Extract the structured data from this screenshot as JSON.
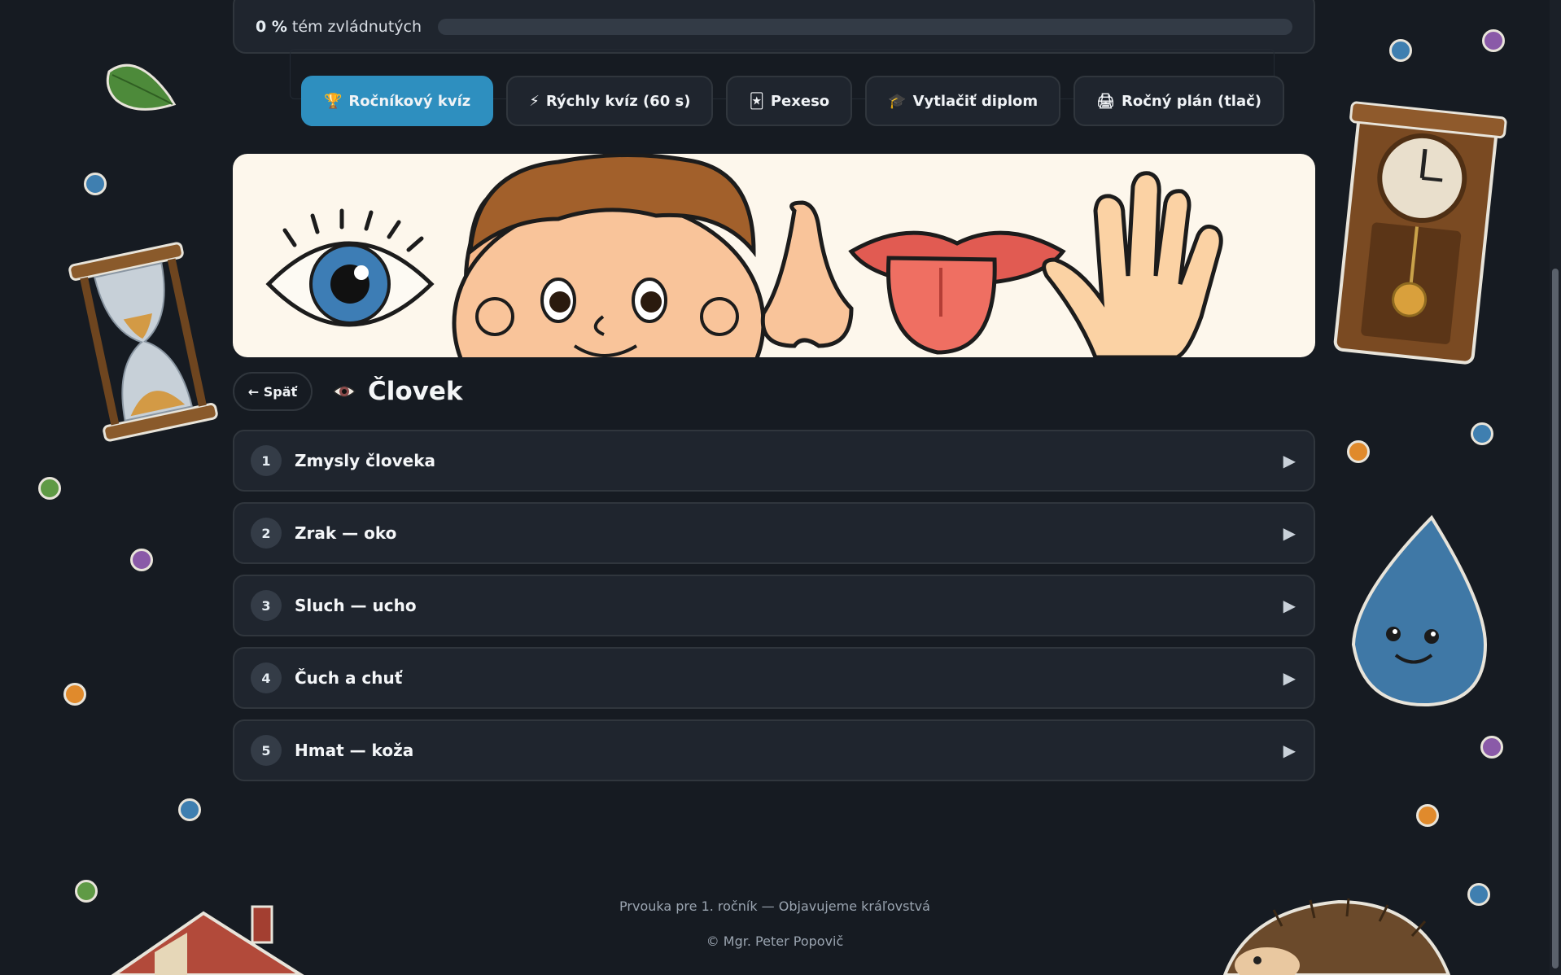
{
  "progress": {
    "percent_label": "0 %",
    "label": "tém zvládnutých",
    "value": 0
  },
  "toolbar": [
    {
      "id": "grade-quiz",
      "icon": "trophy-icon",
      "glyph": "🏆",
      "label": "Ročníkový kvíz",
      "active": true
    },
    {
      "id": "quick-quiz",
      "icon": "lightning-icon",
      "glyph": "⚡",
      "label": "Rýchly kvíz (60 s)",
      "active": false
    },
    {
      "id": "pexeso",
      "icon": "cards-icon",
      "glyph": "🃏",
      "label": "Pexeso",
      "active": false
    },
    {
      "id": "diploma",
      "icon": "graduation-cap-icon",
      "glyph": "🎓",
      "label": "Vytlačiť diplom",
      "active": false
    },
    {
      "id": "annual-plan",
      "icon": "printer-icon",
      "glyph": "🖨",
      "label": "Ročný plán (tlač)",
      "active": false
    }
  ],
  "header": {
    "back_label": "← Späť",
    "title_icon": "eye-icon",
    "title": "Človek"
  },
  "topics": [
    {
      "num": "1",
      "label": "Zmysly človeka"
    },
    {
      "num": "2",
      "label": "Zrak — oko"
    },
    {
      "num": "3",
      "label": "Sluch — ucho"
    },
    {
      "num": "4",
      "label": "Čuch a chuť"
    },
    {
      "num": "5",
      "label": "Hmat — koža"
    }
  ],
  "topic_arrow": "▶",
  "footer": {
    "line1": "Prvouka pre 1. ročník — Objavujeme kráľovstvá",
    "line2": "© Mgr. Peter Popovič"
  },
  "colors": {
    "background": "#161b22",
    "card": "#1f252e",
    "border": "#30363d",
    "accent": "#2e8fbf",
    "banner": "#fdf7ec"
  }
}
